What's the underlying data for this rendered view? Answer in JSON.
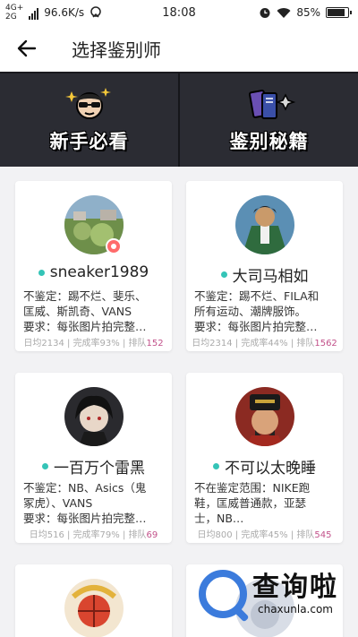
{
  "status": {
    "network_top": "4G+",
    "network_bottom": "2G",
    "speed": "96.6K/s",
    "time": "18:08",
    "battery": "85%"
  },
  "nav": {
    "title": "选择鉴别师"
  },
  "banner": {
    "left_label": "新手必看",
    "right_label": "鉴别秘籍"
  },
  "experts": [
    {
      "name": "sneaker1989",
      "line1": "不鉴定：踢不烂、斐乐、",
      "line2": "匡威、斯凯奇、VANS",
      "line3": "要求：每张图片拍完整…",
      "daily": "日均2134",
      "rate": "完成率93%",
      "queue_label": "排队",
      "queue": "152"
    },
    {
      "name": "大司马相如",
      "line1": "不鉴定：踢不烂、FILA和",
      "line2": "所有运动、潮牌服饰。",
      "line3": "要求：每张图片拍完整…",
      "daily": "日均2314",
      "rate": "完成率44%",
      "queue_label": "排队",
      "queue": "1562"
    },
    {
      "name": "一百万个雷黑",
      "line1": "不鉴定：NB、Asics（鬼",
      "line2": "冢虎）、VANS",
      "line3": "要求：每张图片拍完整…",
      "daily": "日均516",
      "rate": "完成率79%",
      "queue_label": "排队",
      "queue": "69"
    },
    {
      "name": "不可以太晚睡",
      "line1": "不在鉴定范围：NIKE跑",
      "line2": "鞋，匡威普通款，亚瑟",
      "line3": "士，NB…",
      "daily": "日均800",
      "rate": "完成率45%",
      "queue_label": "排队",
      "queue": "545"
    }
  ],
  "watermark": {
    "cn": "查询啦",
    "en": "chaxunla.com"
  },
  "colors": {
    "accent_dot": "#34c4b7",
    "queue": "#c2518a",
    "banner_bg": "#2b2c33"
  }
}
